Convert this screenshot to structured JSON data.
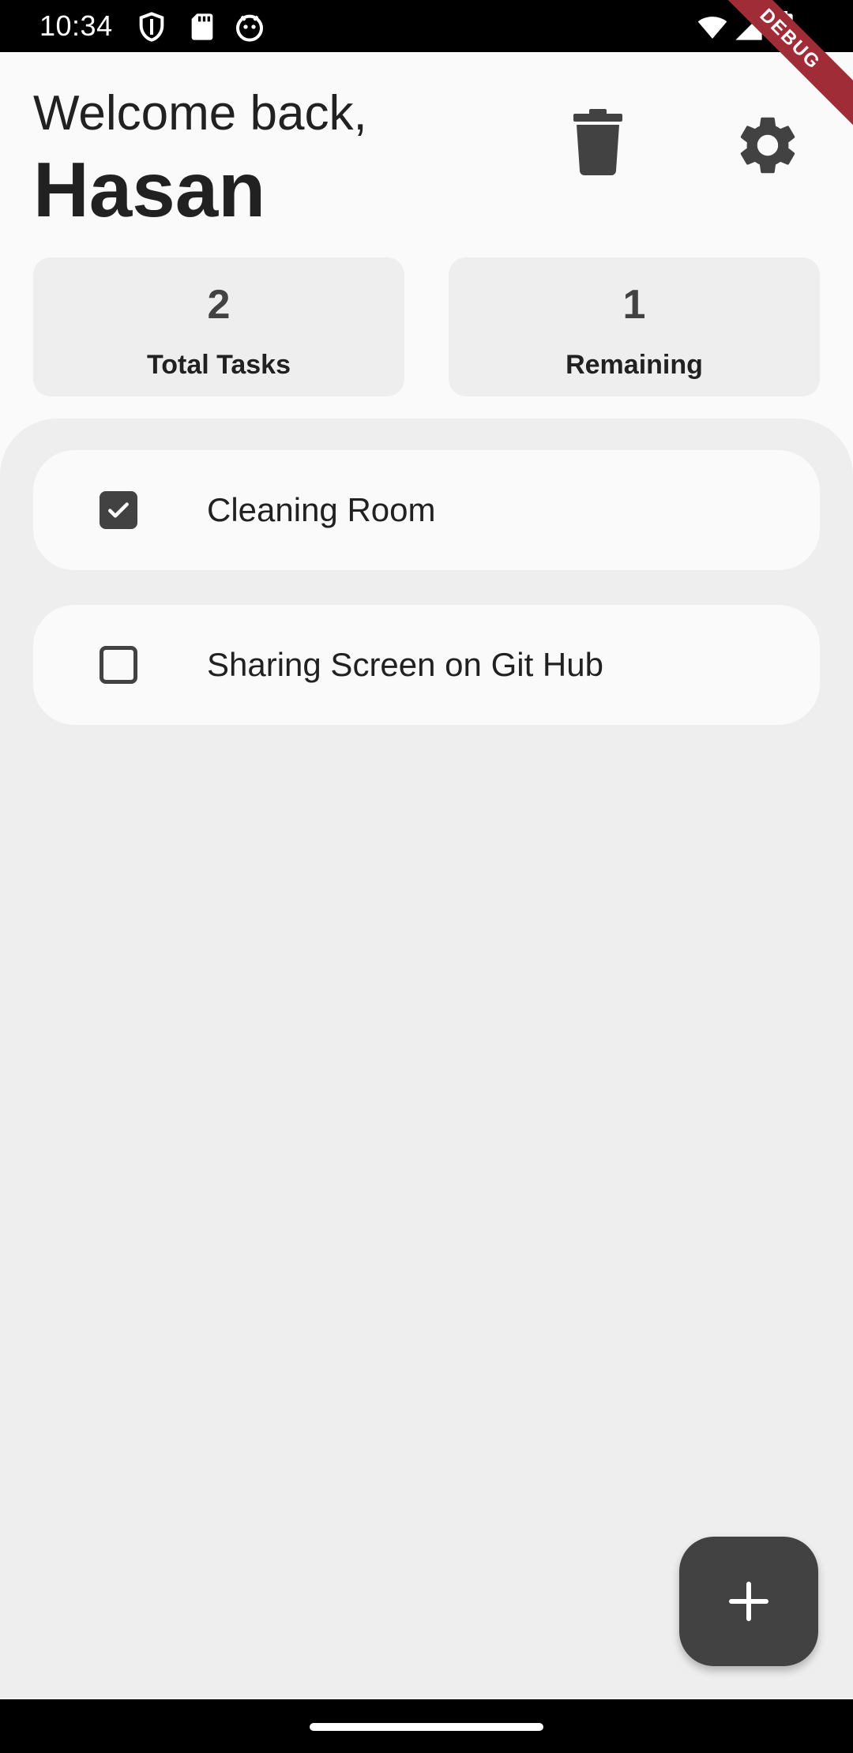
{
  "status_bar": {
    "time": "10:34",
    "left_icons": [
      "shield-icon",
      "sd-card-icon",
      "android-debug-icon"
    ],
    "right_icons": [
      "wifi-icon",
      "signal-icon",
      "battery-icon"
    ]
  },
  "debug_banner": "DEBUG",
  "header": {
    "welcome": "Welcome back,",
    "name": "Hasan",
    "actions": [
      "trash-icon",
      "gear-icon"
    ]
  },
  "stats": {
    "total": {
      "value": "2",
      "label": "Total Tasks"
    },
    "remaining": {
      "value": "1",
      "label": "Remaining"
    }
  },
  "tasks": [
    {
      "title": "Cleaning Room",
      "done": true
    },
    {
      "title": "Sharing Screen on Git Hub",
      "done": false
    }
  ],
  "fab": {
    "icon": "plus-icon"
  },
  "colors": {
    "background": "#fafafa",
    "panel": "#eeeeee",
    "accent": "#424242",
    "text": "#212121",
    "debug": "#a02c38"
  }
}
